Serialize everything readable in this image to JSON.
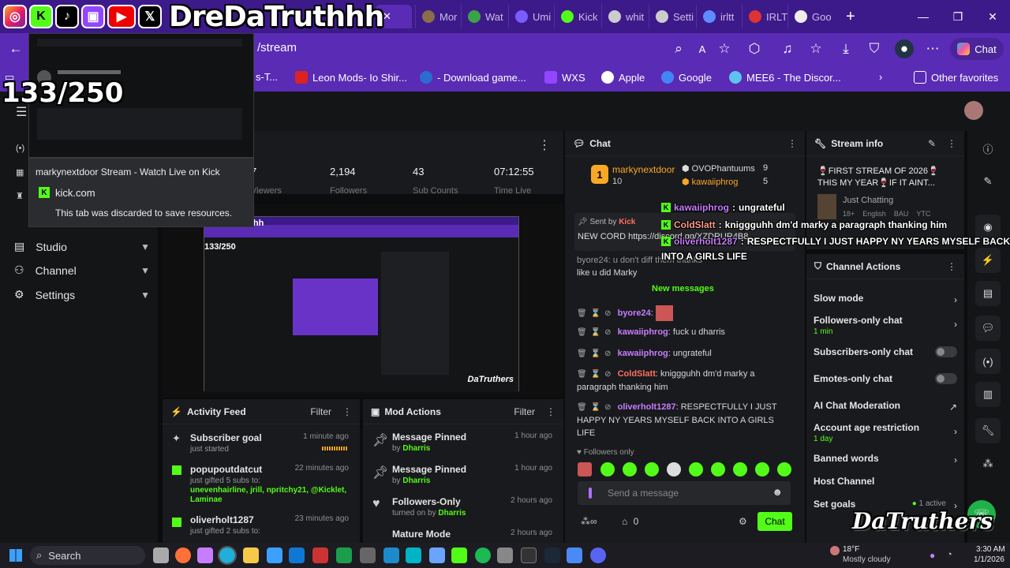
{
  "overlay": {
    "streamer_handle": "DreDaTruthhh",
    "counter": "133/250",
    "watermark": "DaTruthers",
    "social_icons": [
      "instagram-icon",
      "kick-icon",
      "tiktok-icon",
      "twitch-icon",
      "youtube-icon",
      "x-icon"
    ]
  },
  "browser": {
    "tabs": [
      {
        "label": "Mor",
        "color": "#8a6d4a"
      },
      {
        "label": "Wat",
        "color": "#3aa34a"
      },
      {
        "label": "Umi",
        "color": "#7b5cff"
      },
      {
        "label": "Kick",
        "color": "#53fc18"
      },
      {
        "label": "whit",
        "color": "#cccccc"
      },
      {
        "label": "Setti",
        "color": "#cccccc"
      },
      {
        "label": "irltt",
        "color": "#5e8cff"
      },
      {
        "label": "IRLT",
        "color": "#d33"
      },
      {
        "label": "Goo",
        "color": "#eeeeee"
      }
    ],
    "url": "/stream",
    "chat_button": "Chat",
    "favorites": [
      {
        "label": "s-T...",
        "color": "#aaaaaa"
      },
      {
        "label": "Leon Mods- Io Shir...",
        "color": "#d22"
      },
      {
        "label": "- Download game...",
        "color": "#2b6cd3"
      },
      {
        "label": "WXS",
        "color": "#9146ff"
      },
      {
        "label": "Apple",
        "color": "#ffffff"
      },
      {
        "label": "Google",
        "color": "#4285f4"
      },
      {
        "label": "MEE6 - The Discor...",
        "color": "#5fc3f0"
      }
    ],
    "other_favorites": "Other favorites"
  },
  "tab_preview": {
    "title": "markynextdoor Stream - Watch Live on Kick",
    "domain": "kick.com",
    "note": "This tab was discarded to save resources."
  },
  "sidebar": {
    "items": [
      {
        "label": "Studio"
      },
      {
        "label": "Channel"
      },
      {
        "label": "Settings"
      }
    ]
  },
  "stats": [
    {
      "value": "7",
      "label": "Viewers"
    },
    {
      "value": "2,194",
      "label": "Followers"
    },
    {
      "value": "43",
      "label": "Sub Counts"
    },
    {
      "value": "07:12:55",
      "label": "Time Live"
    }
  ],
  "activity_feed": {
    "title": "Activity Feed",
    "filter": "Filter",
    "items": [
      {
        "title": "Subscriber goal",
        "sub": "just started",
        "time": "1 minute ago"
      },
      {
        "title": "popupoutdatcut",
        "sub": "just gifted 5 subs to:",
        "recipients": "unevenhairline, jrill, npritchy21, @Kicklet, Laminae",
        "time": "22 minutes ago"
      },
      {
        "title": "oliverholt1287",
        "sub": "just gifted 2 subs to:",
        "time": "23 minutes ago"
      }
    ]
  },
  "mod_actions": {
    "title": "Mod Actions",
    "filter": "Filter",
    "items": [
      {
        "title": "Message Pinned",
        "sub": "by",
        "by": "Dharris",
        "time": "1 hour ago"
      },
      {
        "title": "Message Pinned",
        "sub": "by",
        "by": "Dharris",
        "time": "1 hour ago"
      },
      {
        "title": "Followers-Only",
        "sub": "turned on by",
        "by": "Dharris",
        "time": "2 hours ago"
      },
      {
        "title": "Mature Mode",
        "sub": "",
        "by": "",
        "time": "2 hours ago"
      }
    ]
  },
  "chat": {
    "title": "Chat",
    "leaderboard": {
      "first_name": "markynextdoor",
      "first_count": "10",
      "second": [
        {
          "name": "OVOPhantuums",
          "count": "9"
        },
        {
          "name": "kawaiiphrog",
          "count": "5"
        }
      ]
    },
    "pinned": {
      "sent_by": "Sent by",
      "sender": "Kick",
      "text": "NEW CORD https://discord.gg/XZDRUR4B8"
    },
    "older": "like u did Marky",
    "older_prefix": "byore24: u don't diff them thanks",
    "new_messages": "New messages",
    "messages": [
      {
        "user": "byore24",
        "text": ""
      },
      {
        "user": "kawaiiphrog",
        "text": "fuck u dharris"
      },
      {
        "user": "kawaiiphrog",
        "text": "ungrateful"
      },
      {
        "user": "ColdSlatt",
        "text": "kniggguhh dm'd marky a paragraph thanking him"
      },
      {
        "user": "oliverholt1287",
        "text": "RESPECTFULLY I JUST HAPPY NY YEARS MYSELF BACK INTO A GIRLS LIFE"
      }
    ],
    "followers_only": "Followers only",
    "placeholder": "Send a message",
    "footer_count": "0",
    "send": "Chat"
  },
  "overlay_chat": [
    {
      "user": "kawaiiphrog",
      "text": "ungrateful"
    },
    {
      "user": "ColdSlatt",
      "text": "kniggguhh dm'd marky a paragraph thanking him"
    },
    {
      "user": "oliverholt1287",
      "text": "RESPECTFULLY I JUST HAPPY NY YEARS MYSELF BACK"
    },
    {
      "user": "",
      "text": "INTO A GIRLS LIFE"
    }
  ],
  "stream_info": {
    "title": "Stream info",
    "stream_title": "🍷FIRST STREAM OF 2026🍷 THIS MY YEAR🍷IF IT AINT...",
    "category": "Just Chatting",
    "tags": [
      "18+",
      "English",
      "BAU",
      "YTC"
    ]
  },
  "channel_actions": {
    "title": "Channel Actions",
    "items": [
      {
        "label": "Slow mode",
        "sub": "",
        "control": "chevron"
      },
      {
        "label": "Followers-only chat",
        "sub": "1 min",
        "control": "chevron"
      },
      {
        "label": "Subscribers-only chat",
        "sub": "",
        "control": "toggle"
      },
      {
        "label": "Emotes-only chat",
        "sub": "",
        "control": "toggle"
      },
      {
        "label": "AI Chat Moderation",
        "sub": "",
        "control": "external"
      },
      {
        "label": "Account age restriction",
        "sub": "1 day",
        "control": "chevron"
      },
      {
        "label": "Banned words",
        "sub": "",
        "control": "chevron"
      },
      {
        "label": "Host Channel",
        "sub": "",
        "control": "none"
      },
      {
        "label": "Set goals",
        "sub": "",
        "badge": "1 active",
        "control": "chevron"
      }
    ]
  },
  "taskbar": {
    "search": "Search",
    "weather_temp": "18°F",
    "weather_desc": "Mostly cloudy",
    "time": "3:30 AM",
    "date": "1/1/2026"
  },
  "colors": {
    "kick_green": "#53fc18",
    "browser_purple": "#5a2bb5",
    "tabbar_purple": "#3d1a8a"
  }
}
